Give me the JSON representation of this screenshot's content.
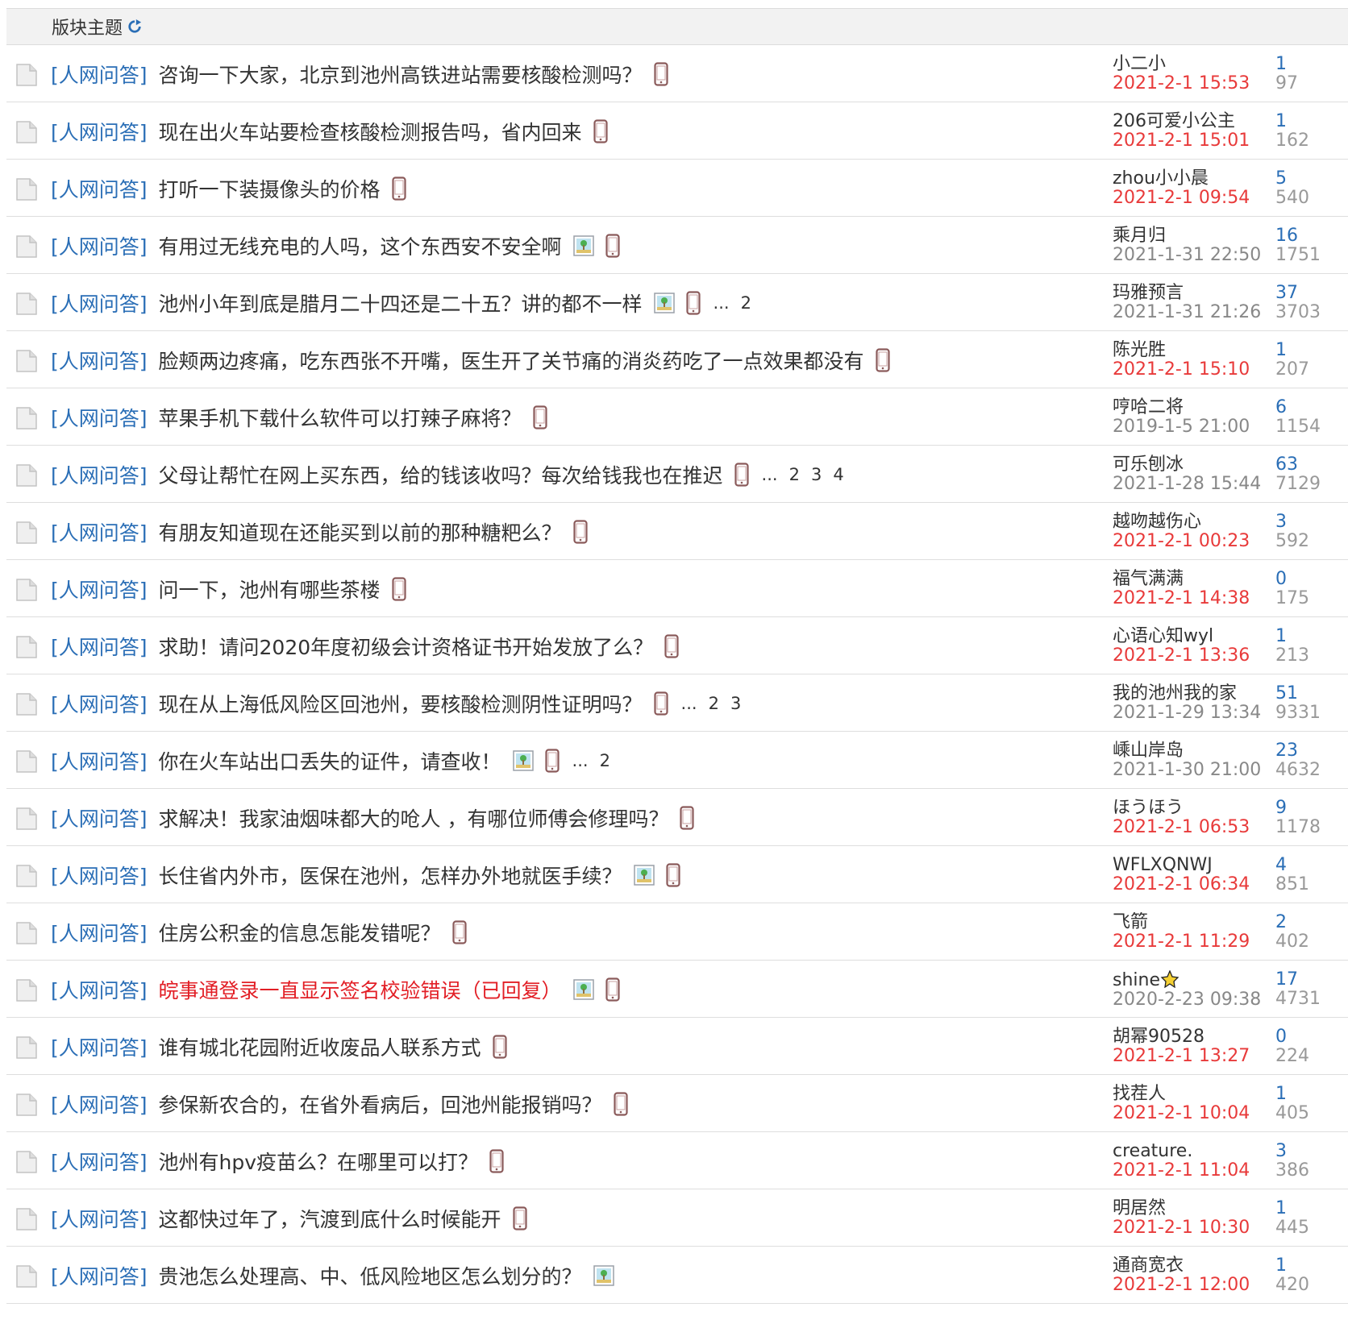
{
  "header": {
    "title": "版块主题"
  },
  "threads": [
    {
      "tag": "[人网问答]",
      "title": "咨询一下大家，北京到池州高铁进站需要核酸检测吗？",
      "img": false,
      "phone": true,
      "pages": [],
      "author": "小二小",
      "time": "2021-2-1 15:53",
      "recent": true,
      "replies": "1",
      "views": "97"
    },
    {
      "tag": "[人网问答]",
      "title": "现在出火车站要检查核酸检测报告吗，省内回来",
      "img": false,
      "phone": true,
      "pages": [],
      "author": "206可爱小公主",
      "time": "2021-2-1 15:01",
      "recent": true,
      "replies": "1",
      "views": "162"
    },
    {
      "tag": "[人网问答]",
      "title": "打听一下装摄像头的价格",
      "img": false,
      "phone": true,
      "pages": [],
      "author": "zhou小小晨",
      "time": "2021-2-1 09:54",
      "recent": true,
      "replies": "5",
      "views": "540"
    },
    {
      "tag": "[人网问答]",
      "title": "有用过无线充电的人吗，这个东西安不安全啊",
      "img": true,
      "phone": true,
      "pages": [],
      "author": "乘月归",
      "time": "2021-1-31 22:50",
      "recent": false,
      "replies": "16",
      "views": "1751"
    },
    {
      "tag": "[人网问答]",
      "title": "池州小年到底是腊月二十四还是二十五？讲的都不一样",
      "img": true,
      "phone": true,
      "pages": [
        "...",
        "2"
      ],
      "author": "玛雅预言",
      "time": "2021-1-31 21:26",
      "recent": false,
      "replies": "37",
      "views": "3703"
    },
    {
      "tag": "[人网问答]",
      "title": "脸颊两边疼痛，吃东西张不开嘴，医生开了关节痛的消炎药吃了一点效果都没有",
      "img": false,
      "phone": true,
      "pages": [],
      "author": "陈光胜",
      "time": "2021-2-1 15:10",
      "recent": true,
      "replies": "1",
      "views": "207"
    },
    {
      "tag": "[人网问答]",
      "title": "苹果手机下载什么软件可以打辣子麻将？",
      "img": false,
      "phone": true,
      "pages": [],
      "author": "哼哈二将",
      "time": "2019-1-5 21:00",
      "recent": false,
      "replies": "6",
      "views": "1154"
    },
    {
      "tag": "[人网问答]",
      "title": "父母让帮忙在网上买东西，给的钱该收吗？每次给钱我也在推迟",
      "img": false,
      "phone": true,
      "pages": [
        "...",
        "2",
        "3",
        "4"
      ],
      "author": "可乐刨冰",
      "time": "2021-1-28 15:44",
      "recent": false,
      "replies": "63",
      "views": "7129"
    },
    {
      "tag": "[人网问答]",
      "title": "有朋友知道现在还能买到以前的那种糖粑么？",
      "img": false,
      "phone": true,
      "pages": [],
      "author": "越吻越伤心",
      "time": "2021-2-1 00:23",
      "recent": true,
      "replies": "3",
      "views": "592"
    },
    {
      "tag": "[人网问答]",
      "title": "问一下，池州有哪些茶楼",
      "img": false,
      "phone": true,
      "pages": [],
      "author": "福气满满",
      "time": "2021-2-1 14:38",
      "recent": true,
      "replies": "0",
      "views": "175"
    },
    {
      "tag": "[人网问答]",
      "title": "求助！请问2020年度初级会计资格证书开始发放了么？",
      "img": false,
      "phone": true,
      "pages": [],
      "author": "心语心知wyl",
      "time": "2021-2-1 13:36",
      "recent": true,
      "replies": "1",
      "views": "213"
    },
    {
      "tag": "[人网问答]",
      "title": "现在从上海低风险区回池州，要核酸检测阴性证明吗？",
      "img": false,
      "phone": true,
      "pages": [
        "...",
        "2",
        "3"
      ],
      "author": "我的池州我的家",
      "time": "2021-1-29 13:34",
      "recent": false,
      "replies": "51",
      "views": "9331"
    },
    {
      "tag": "[人网问答]",
      "title": "你在火车站出口丢失的证件，请查收！",
      "img": true,
      "phone": true,
      "pages": [
        "...",
        "2"
      ],
      "author": "嵊山岸岛",
      "time": "2021-1-30 21:00",
      "recent": false,
      "replies": "23",
      "views": "4632"
    },
    {
      "tag": "[人网问答]",
      "title": "求解决！我家油烟味都大的呛人 ，有哪位师傅会修理吗？",
      "img": false,
      "phone": true,
      "pages": [],
      "author": "ほうほう",
      "time": "2021-2-1 06:53",
      "recent": true,
      "replies": "9",
      "views": "1178"
    },
    {
      "tag": "[人网问答]",
      "title": "长住省内外市，医保在池州，怎样办外地就医手续？",
      "img": true,
      "phone": true,
      "pages": [],
      "author": "WFLXQNWJ",
      "time": "2021-2-1 06:34",
      "recent": true,
      "replies": "4",
      "views": "851"
    },
    {
      "tag": "[人网问答]",
      "title": "住房公积金的信息怎能发错呢？",
      "img": false,
      "phone": true,
      "pages": [],
      "author": "飞箭",
      "time": "2021-2-1 11:29",
      "recent": true,
      "replies": "2",
      "views": "402"
    },
    {
      "tag": "[人网问答]",
      "title": "皖事通登录一直显示签名校验错误（已回复）",
      "titleRed": true,
      "img": true,
      "phone": true,
      "pages": [],
      "author": "shine",
      "star": true,
      "time": "2020-2-23 09:38",
      "recent": false,
      "replies": "17",
      "views": "4731"
    },
    {
      "tag": "[人网问答]",
      "title": "谁有城北花园附近收废品人联系方式",
      "img": false,
      "phone": true,
      "pages": [],
      "author": "胡幂90528",
      "time": "2021-2-1 13:27",
      "recent": true,
      "replies": "0",
      "views": "224"
    },
    {
      "tag": "[人网问答]",
      "title": "参保新农合的，在省外看病后，回池州能报销吗？",
      "img": false,
      "phone": true,
      "pages": [],
      "author": "找茬人",
      "time": "2021-2-1 10:04",
      "recent": true,
      "replies": "1",
      "views": "405"
    },
    {
      "tag": "[人网问答]",
      "title": "池州有hpv疫苗么？在哪里可以打？",
      "img": false,
      "phone": true,
      "pages": [],
      "author": "creature.",
      "time": "2021-2-1 11:04",
      "recent": true,
      "replies": "3",
      "views": "386"
    },
    {
      "tag": "[人网问答]",
      "title": "这都快过年了，汽渡到底什么时候能开",
      "img": false,
      "phone": true,
      "pages": [],
      "author": "明居然",
      "time": "2021-2-1 10:30",
      "recent": true,
      "replies": "1",
      "views": "445"
    },
    {
      "tag": "[人网问答]",
      "title": "贵池怎么处理高、中、低风险地区怎么划分的？",
      "img": true,
      "phone": false,
      "pages": [],
      "author": "通商宽衣",
      "time": "2021-2-1 12:00",
      "recent": true,
      "replies": "1",
      "views": "420"
    }
  ],
  "colors": {
    "tag": "#2a6eb6",
    "recent_time": "#e83a3a",
    "old_time": "#888888",
    "red_title": "#e21f26"
  },
  "icons": {
    "refresh": "refresh-icon",
    "thread": "document-icon",
    "image": "image-attachment-icon",
    "phone": "mobile-post-icon",
    "star": "star-medal-icon"
  }
}
